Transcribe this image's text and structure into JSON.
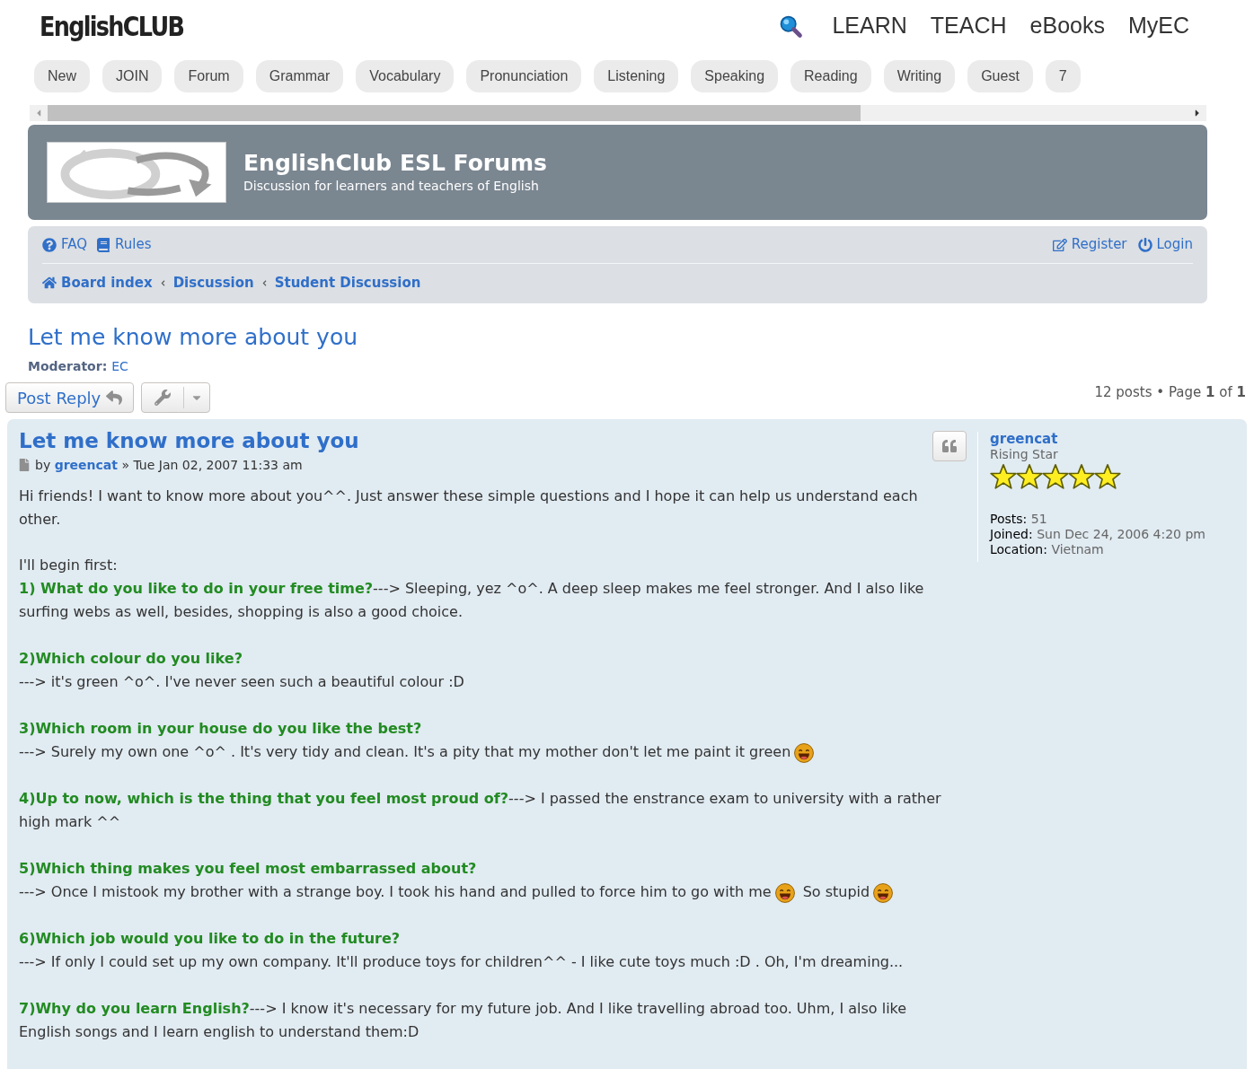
{
  "header": {
    "logo": "EnglishCLUB",
    "links": [
      "LEARN",
      "TEACH",
      "eBooks",
      "MyEC"
    ]
  },
  "menu_pills": [
    "New",
    "JOIN",
    "Forum",
    "Grammar",
    "Vocabulary",
    "Pronunciation",
    "Listening",
    "Speaking",
    "Reading",
    "Writing",
    "Guest",
    "7"
  ],
  "banner": {
    "title": "EnglishClub ESL Forums",
    "subtitle": "Discussion for learners and teachers of English"
  },
  "navbar": {
    "left_links": [
      {
        "kind": "faq",
        "label": "FAQ"
      },
      {
        "kind": "rules",
        "label": "Rules"
      }
    ],
    "right_links": [
      {
        "kind": "register",
        "label": "Register"
      },
      {
        "kind": "login",
        "label": "Login"
      }
    ],
    "breadcrumbs": [
      "Board index",
      "Discussion",
      "Student Discussion"
    ]
  },
  "topic": {
    "title": "Let me know more about you",
    "moderator_label": "Moderator:",
    "moderator": "EC",
    "post_reply": "Post Reply",
    "pagination": {
      "posts": "12 posts",
      "separator": "•",
      "page_label": "Page",
      "page": "1",
      "of": "of",
      "total": "1"
    }
  },
  "post": {
    "title": "Let me know more about you",
    "by": "by",
    "author": "greencat",
    "date": "» Tue Jan 02, 2007 11:33 am",
    "intro": "Hi friends! I want to know more about you^^. Just answer these simple questions and I hope it can help us understand each other.",
    "lead": "I'll begin first:",
    "questions": [
      {
        "question": "1) What do you like to do in your free time?",
        "answer_on_new_line": false,
        "answer": [
          {
            "kind": "text",
            "text": "---> Sleeping, yez ^o^. A deep sleep makes me feel stronger. And I also like surfing webs as well, besides, shopping is also a good choice."
          }
        ]
      },
      {
        "question": "2)Which colour do you like?",
        "answer_on_new_line": true,
        "answer": [
          {
            "kind": "text",
            "text": "---> it's green ^o^. I've never seen such a beautiful colour :D"
          }
        ]
      },
      {
        "question": "3)Which room in your house do you like the best?",
        "answer_on_new_line": true,
        "answer": [
          {
            "kind": "text",
            "text": "---> Surely my own one ^o^ . It's very tidy and clean. It's a pity that my mother don't let me paint it green"
          },
          {
            "kind": "emoji"
          }
        ]
      },
      {
        "question": "4)Up to now, which is the thing that you feel most proud of?",
        "answer_on_new_line": false,
        "answer": [
          {
            "kind": "text",
            "text": "---> I passed the enstrance exam to university with a rather high mark ^^"
          }
        ]
      },
      {
        "question": "5)Which thing makes you feel most embarrassed about?",
        "answer_on_new_line": true,
        "answer": [
          {
            "kind": "text",
            "text": "---> Once I mistook my brother with a strange boy. I took his hand and pulled to force him to go with me"
          },
          {
            "kind": "emoji"
          },
          {
            "kind": "text",
            "text": "So stupid"
          },
          {
            "kind": "emoji"
          }
        ]
      },
      {
        "question": "6)Which job would you like to do in the future?",
        "answer_on_new_line": true,
        "answer": [
          {
            "kind": "text",
            "text": "---> If only I could set up my own company. It'll produce toys for children^^ - I like cute toys much :D . Oh, I'm dreaming..."
          }
        ]
      },
      {
        "question": "7)Why do you learn English?",
        "answer_on_new_line": false,
        "answer": [
          {
            "kind": "text",
            "text": "---> I know it's necessary for my future job. And I like travelling abroad too. Uhm, I also like English songs and I learn english to understand them:D"
          }
        ]
      }
    ],
    "profile": {
      "name": "greencat",
      "rank": "Rising Star",
      "stars": 5,
      "fields": [
        {
          "label": "Posts:",
          "value": "51"
        },
        {
          "label": "Joined:",
          "value": "Sun Dec 24, 2006 4:20 pm"
        },
        {
          "label": "Location:",
          "value": "Vietnam"
        }
      ]
    }
  }
}
